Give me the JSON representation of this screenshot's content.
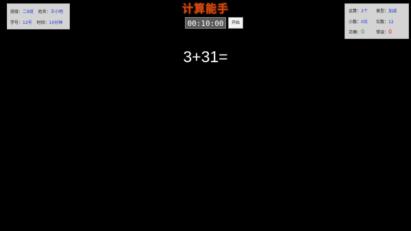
{
  "title": "计算能手",
  "student": {
    "class_label": "班级：",
    "class_value": "二9班",
    "name_label": "姓名：",
    "name_value": "王小明",
    "id_label": "学号：",
    "id_value": "12号",
    "time_label": "时间：",
    "time_value": "10分钟"
  },
  "timer": {
    "display": "00:10:00",
    "start_label": "开始"
  },
  "settings": {
    "operation_label": "运算：",
    "operation_value": "2个",
    "type_label": "类型：",
    "type_value": "加减",
    "decimal_label": "小数：",
    "decimal_value": "0位",
    "digits_label": "位数：",
    "digits_value": "12",
    "correct_label": "正确：",
    "correct_value": "0",
    "wrong_label": "错误：",
    "wrong_value": "0"
  },
  "question": "3+31=",
  "colors": {
    "background": "#000000",
    "panel": "#d4d4d4",
    "value_blue": "#1a2bd6",
    "title_orange": "#d84a12",
    "correct_green": "#18a51c",
    "wrong_red": "#e21b1b"
  }
}
